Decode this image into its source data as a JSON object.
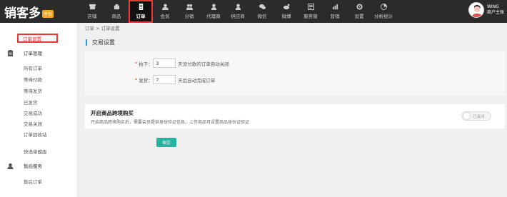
{
  "logo": {
    "text": "销客多",
    "badge": "平台"
  },
  "nav": [
    {
      "label": "店铺",
      "icon": "store-icon"
    },
    {
      "label": "商品",
      "icon": "goods-icon"
    },
    {
      "label": "订单",
      "icon": "order-icon"
    },
    {
      "label": "会员",
      "icon": "member-icon"
    },
    {
      "label": "分销",
      "icon": "distribution-icon"
    },
    {
      "label": "代理商",
      "icon": "agent-icon"
    },
    {
      "label": "供应商",
      "icon": "supplier-icon"
    },
    {
      "label": "微信",
      "icon": "wechat-icon"
    },
    {
      "label": "微博",
      "icon": "weibo-icon"
    },
    {
      "label": "服务窗",
      "icon": "service-window-icon"
    },
    {
      "label": "营销",
      "icon": "marketing-icon"
    },
    {
      "label": "设置",
      "icon": "settings-icon"
    },
    {
      "label": "分析统计",
      "icon": "analytics-icon"
    }
  ],
  "user": {
    "name": "WING",
    "role": "商户主账"
  },
  "sidebar": {
    "active": "订单设置",
    "order_group": "订单管理",
    "order_items": [
      "所有订单",
      "等待付款",
      "等待发货",
      "已发货",
      "交易成功",
      "交易关闭",
      "订单回收站"
    ],
    "express": "快递单模版",
    "aftersale_group": "售后服务",
    "aftersale_items": [
      "售后订单"
    ]
  },
  "breadcrumb": "订单 > 订单设置",
  "panel": {
    "title": "交易设置",
    "order": {
      "label": "拍下：",
      "value": "3",
      "suffix": "天没付款的订单自动关闭"
    },
    "ship": {
      "label": "发货：",
      "value": "7",
      "suffix": "天后自动完成订单"
    }
  },
  "crossborder": {
    "title": "开启商品跨境购买",
    "desc": "开启商品跨境购买后，需要会员提供身份验证信息，上传商品可设置商品身份证验证",
    "toggle_text": "已关闭"
  },
  "save_label": "保存"
}
